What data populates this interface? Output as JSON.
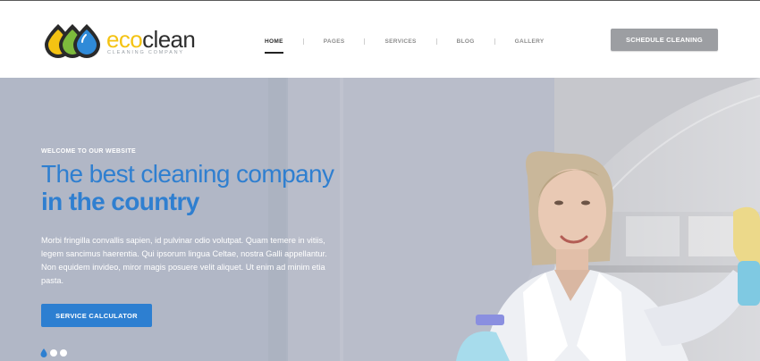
{
  "brand": {
    "name_part1": "eco",
    "name_part2": "clean",
    "tagline": "cleaning company",
    "colors": {
      "yellow": "#f4c313",
      "green": "#7dbb3c",
      "blue": "#2f7fd0",
      "dark": "#2e2e2e"
    }
  },
  "nav": {
    "items": [
      {
        "label": "HOME",
        "active": true
      },
      {
        "label": "PAGES",
        "active": false
      },
      {
        "label": "SERVICES",
        "active": false
      },
      {
        "label": "BLOG",
        "active": false
      },
      {
        "label": "GALLERY",
        "active": false
      }
    ]
  },
  "header": {
    "cta_label": "SCHEDULE CLEANING"
  },
  "hero": {
    "kicker": "WELCOME TO OUR WEBSITE",
    "title_line1": "The best cleaning company",
    "title_line2": "in the country",
    "body": "Morbi fringilla convallis sapien, id pulvinar odio volutpat. Quam temere in vitiis, legem sancimus haerentia. Qui ipsorum lingua Celtae, nostra Galli appellantur. Non equidem invideo, miror magis posuere velit aliquet. Ut enim ad minim etia pasta.",
    "button_label": "SERVICE CALCULATOR",
    "accent": "#2d7fd1"
  },
  "slider": {
    "slide_count": 3,
    "active_index": 0
  }
}
